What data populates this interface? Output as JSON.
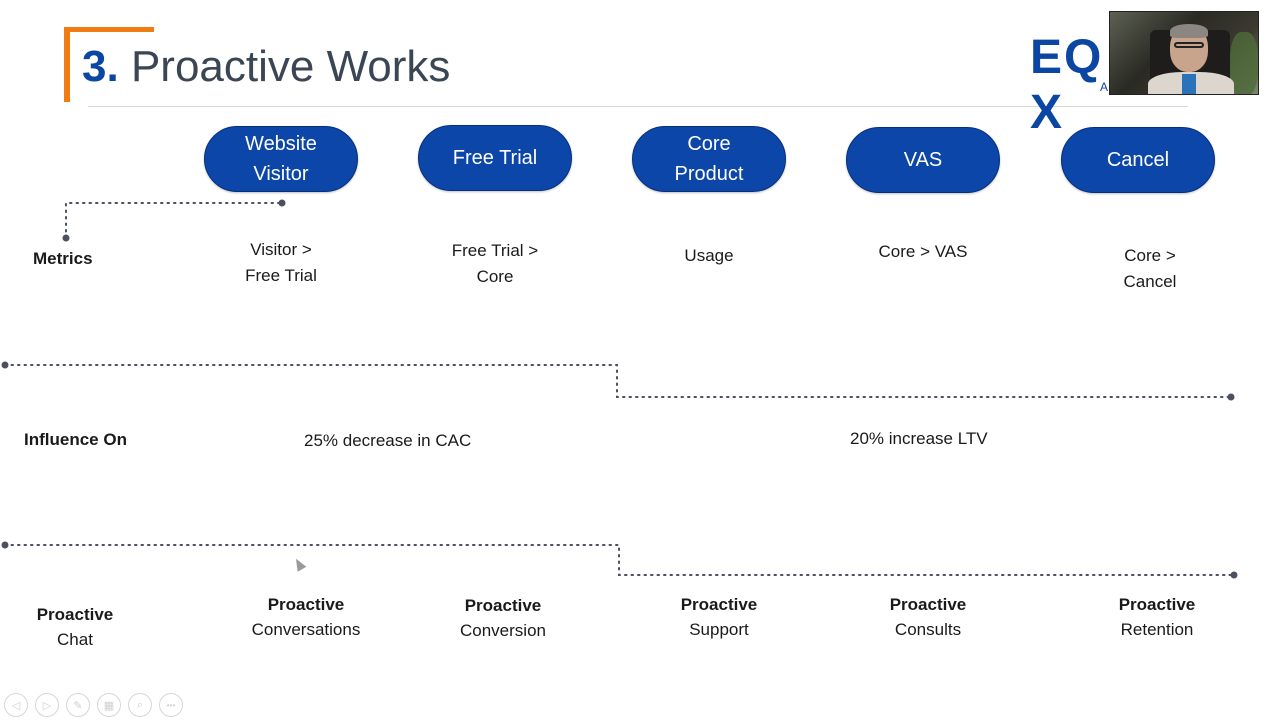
{
  "slide": {
    "title_number": "3.",
    "title_text": "Proactive Works",
    "accent_color": "#f07c14",
    "brand_color": "#0b46a8"
  },
  "logo": {
    "text": "EQUINIX",
    "visible_text": "EQ",
    "visible_suffix": "X",
    "sub_visible": "A"
  },
  "webcam": {
    "label": "participant-video"
  },
  "stages": [
    {
      "label": "Website Visitor",
      "line1": "Website",
      "line2": "Visitor"
    },
    {
      "label": "Free Trial",
      "line1": "Free Trial",
      "line2": ""
    },
    {
      "label": "Core Product",
      "line1": "Core",
      "line2": "Product"
    },
    {
      "label": "VAS",
      "line1": "VAS",
      "line2": ""
    },
    {
      "label": "Cancel",
      "line1": "Cancel",
      "line2": ""
    }
  ],
  "rows": {
    "metrics_label": "Metrics",
    "influence_label": "Influence On"
  },
  "metrics": [
    {
      "line1": "Visitor >",
      "line2": "Free Trial"
    },
    {
      "line1": "Free Trial >",
      "line2": "Core"
    },
    {
      "line1": "Usage",
      "line2": ""
    },
    {
      "line1": "Core > VAS",
      "line2": ""
    },
    {
      "line1": "Core >",
      "line2": "Cancel"
    }
  ],
  "influence": [
    {
      "text": "25% decrease in CAC"
    },
    {
      "text": "20% increase LTV"
    }
  ],
  "proactive": [
    {
      "bold": "Proactive",
      "regular": "Chat"
    },
    {
      "bold": "Proactive",
      "regular": "Conversations"
    },
    {
      "bold": "Proactive",
      "regular": "Conversion"
    },
    {
      "bold": "Proactive",
      "regular": "Support"
    },
    {
      "bold": "Proactive",
      "regular": "Consults"
    },
    {
      "bold": "Proactive",
      "regular": "Retention"
    }
  ],
  "presenter_controls": [
    {
      "name": "previous-slide",
      "glyph": "◁"
    },
    {
      "name": "next-slide",
      "glyph": "▷"
    },
    {
      "name": "pen",
      "glyph": "✎"
    },
    {
      "name": "see-all-slides",
      "glyph": "▦"
    },
    {
      "name": "zoom",
      "glyph": "⌕"
    },
    {
      "name": "more-options",
      "glyph": "•••"
    }
  ]
}
